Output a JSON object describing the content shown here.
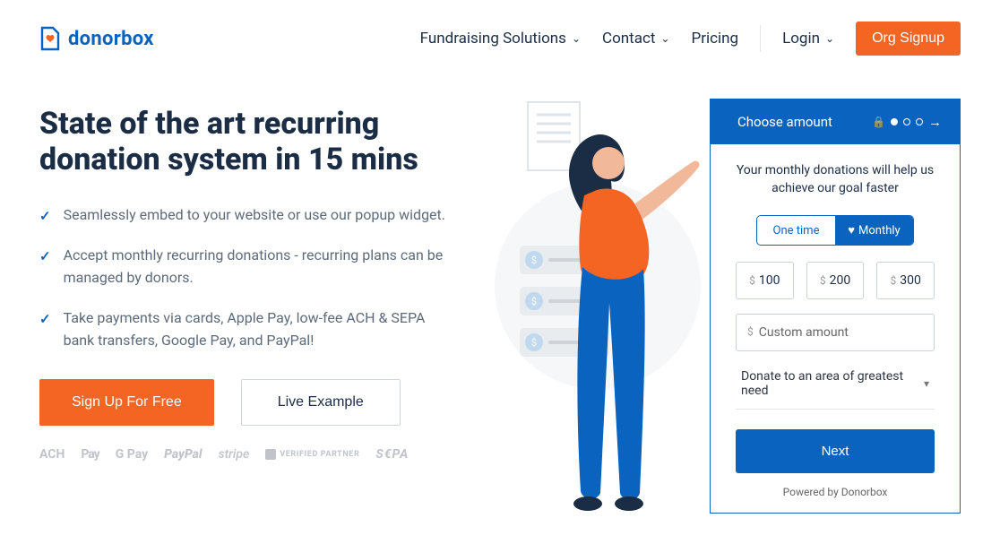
{
  "logo": {
    "text": "donorbox"
  },
  "nav": {
    "items": [
      {
        "label": "Fundraising Solutions",
        "has_chevron": true
      },
      {
        "label": "Contact",
        "has_chevron": true
      },
      {
        "label": "Pricing",
        "has_chevron": false
      }
    ],
    "login": "Login",
    "signup": "Org Signup"
  },
  "hero": {
    "title": "State of the art recurring donation system in 15 mins",
    "features": [
      "Seamlessly embed to your website or use our popup widget.",
      "Accept monthly recurring donations - recurring plans can be managed by donors.",
      "Take payments via cards, Apple Pay, low-fee ACH & SEPA bank transfers, Google Pay, and PayPal!"
    ],
    "cta_primary": "Sign Up For Free",
    "cta_secondary": "Live Example",
    "payment_logos": {
      "ach": "ACH",
      "apple_pay": "Pay",
      "gpay": "G Pay",
      "paypal": "PayPal",
      "stripe": "stripe",
      "verified": "VERIFIED PARTNER",
      "sepa": "S€PA"
    }
  },
  "form": {
    "header": "Choose amount",
    "subtitle": "Your monthly donations will help us achieve our goal faster",
    "freq_one": "One time",
    "freq_monthly": "Monthly",
    "currency": "$",
    "amounts": [
      "100",
      "200",
      "300"
    ],
    "custom_placeholder": "Custom amount",
    "dropdown": "Donate to an area of greatest need",
    "next": "Next",
    "powered": "Powered by Donorbox"
  }
}
